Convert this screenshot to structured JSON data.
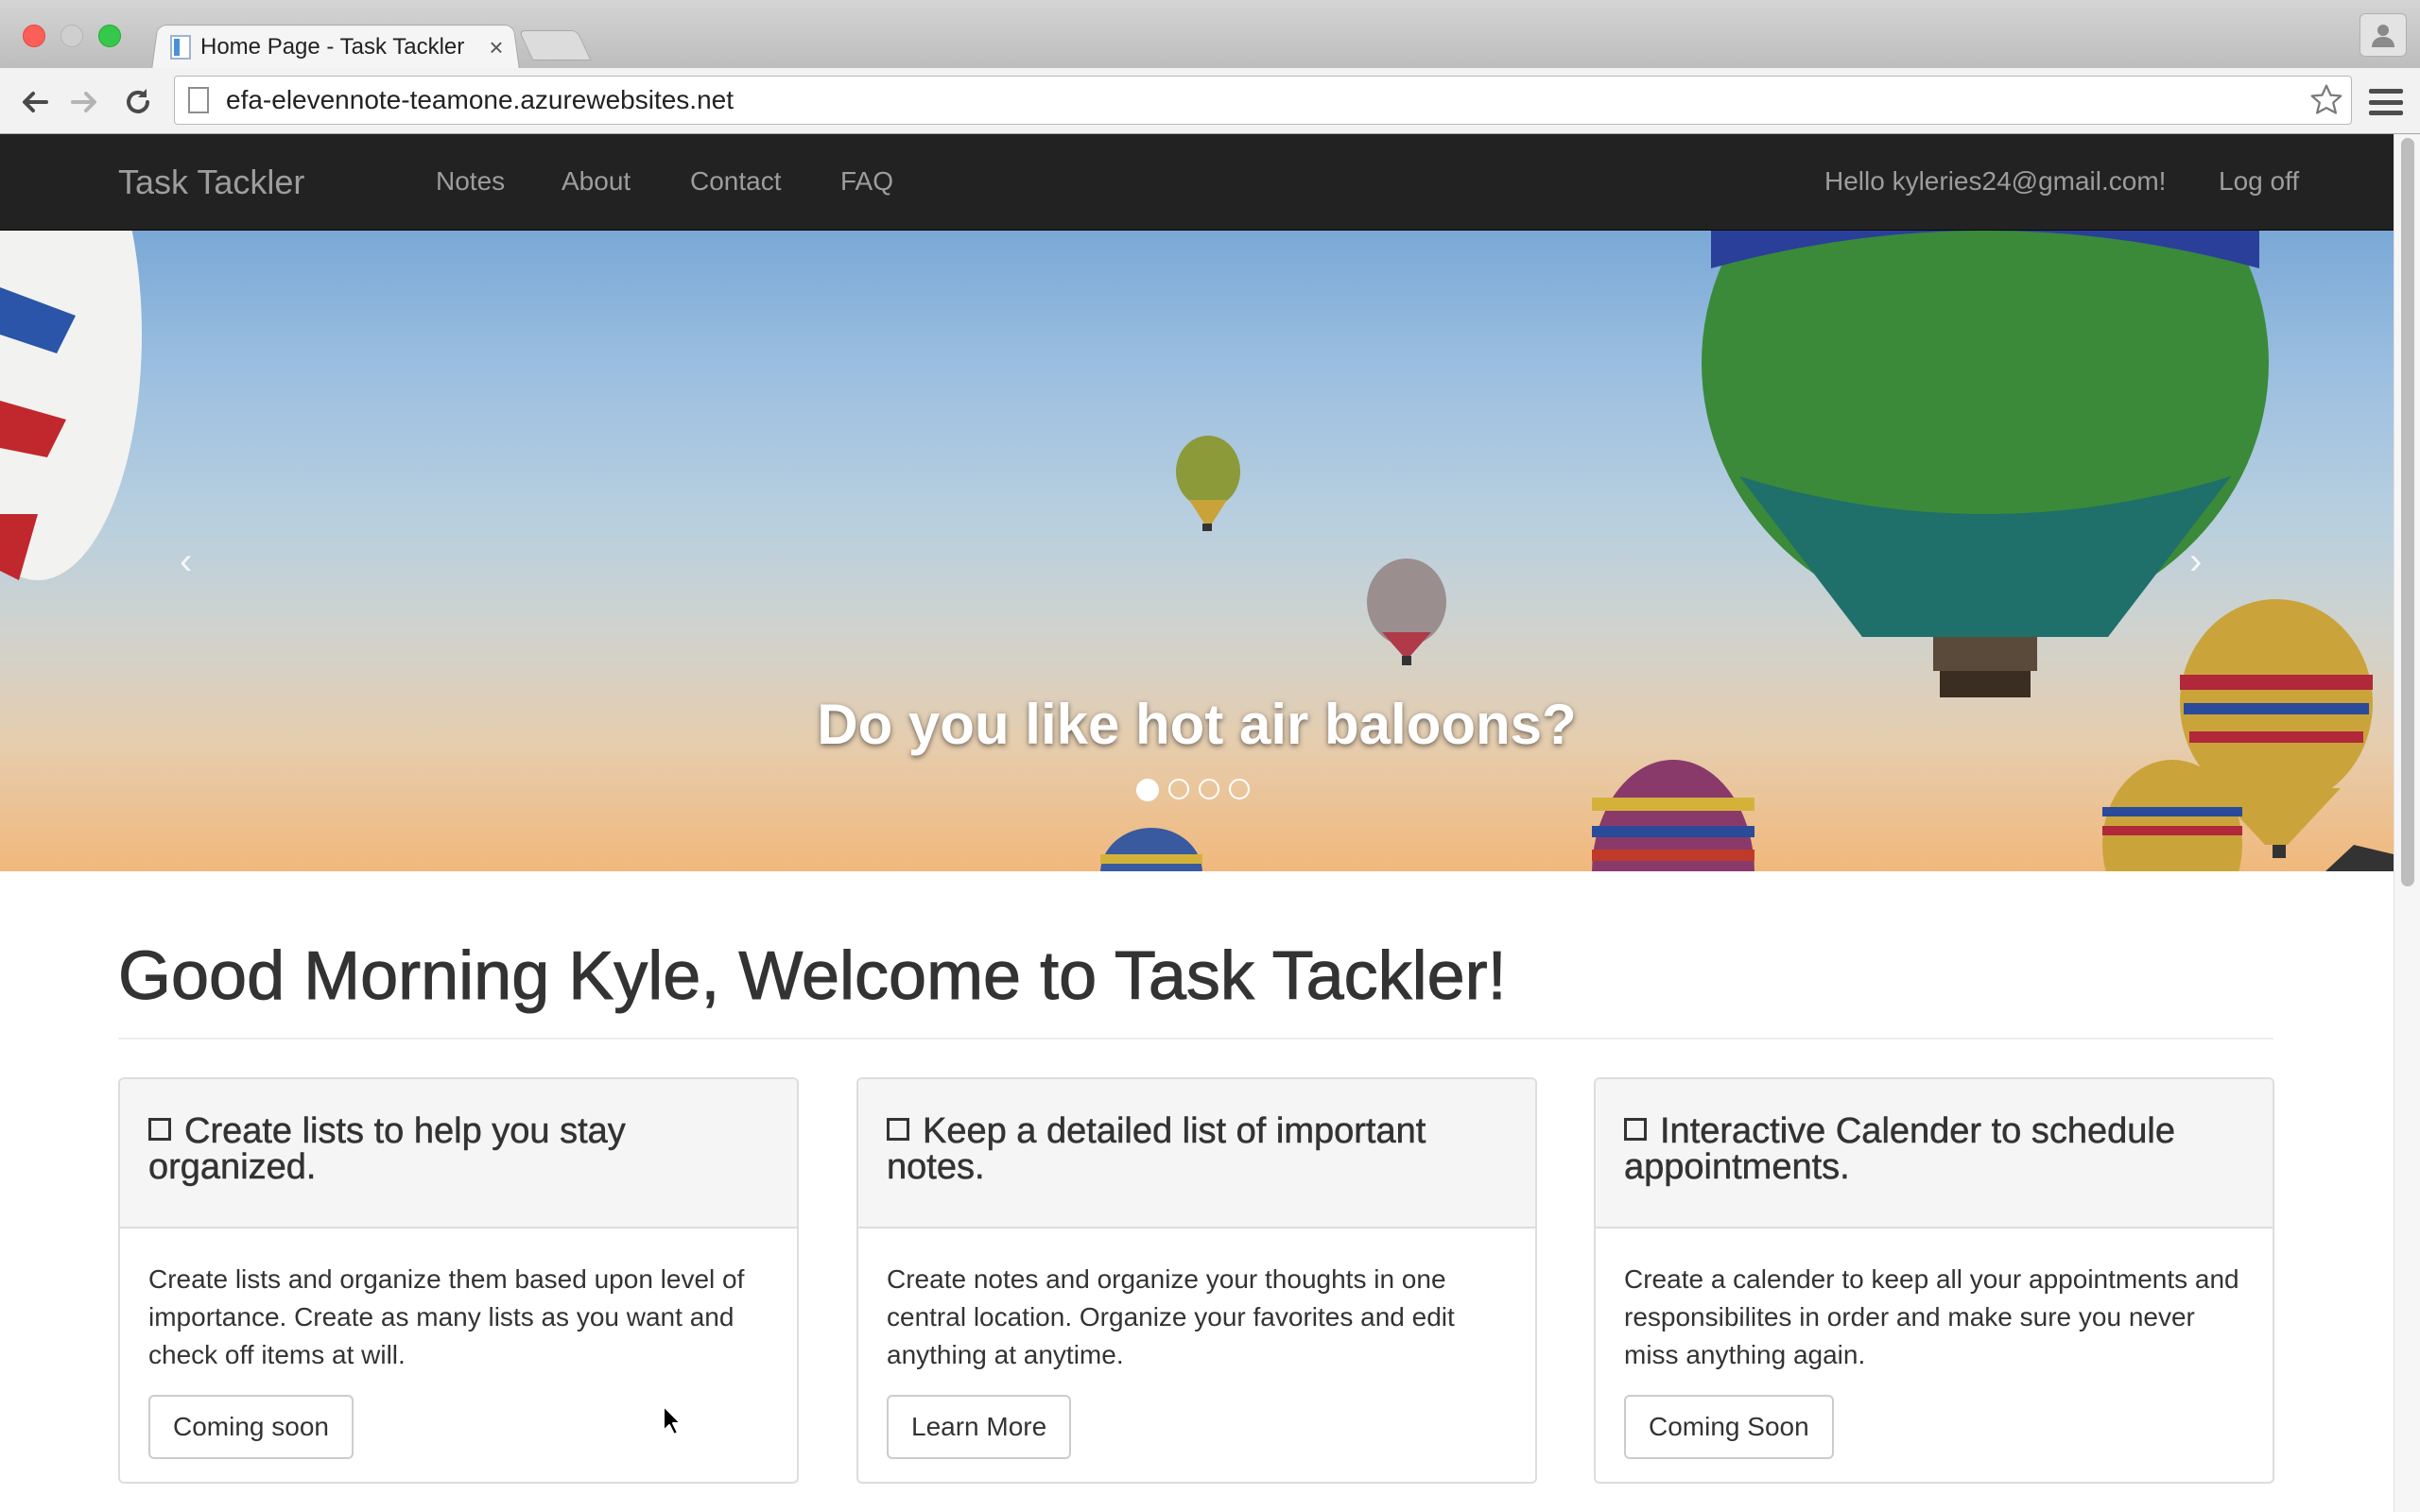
{
  "browser": {
    "tab_title": "Home Page - Task Tackler",
    "tab_close": "×",
    "url": "efa-elevennote-teamone.azurewebsites.net"
  },
  "site_nav": {
    "brand": "Task Tackler",
    "links": [
      "Notes",
      "About",
      "Contact",
      "FAQ"
    ],
    "greeting": "Hello kyleries24@gmail.com!",
    "logoff": "Log off"
  },
  "carousel": {
    "caption": "Do you like hot air baloons?",
    "prev": "‹",
    "next": "›",
    "slide_count": 4,
    "active_index": 0
  },
  "main": {
    "heading": "Good Morning Kyle, Welcome to Task Tackler!",
    "panels": [
      {
        "title": "Create lists to help you stay organized.",
        "text": "Create lists and organize them based upon level of importance. Create as many lists as you want and check off items at will.",
        "button": "Coming soon"
      },
      {
        "title": "Keep a detailed list of important notes.",
        "text": "Create notes and organize your thoughts in one central location. Organize your favorites and edit anything at anytime.",
        "button": "Learn More"
      },
      {
        "title": "Interactive Calender to schedule appointments.",
        "text": "Create a calender to keep all your appointments and responsibilites in order and make sure you never miss anything again.",
        "button": "Coming Soon"
      }
    ]
  },
  "icons": {
    "back": "back-arrow-icon",
    "forward": "forward-arrow-icon",
    "reload": "reload-icon",
    "star": "star-icon",
    "menu": "hamburger-menu-icon",
    "profile": "profile-icon",
    "checkbox": "checkbox-icon"
  },
  "colors": {
    "navbar": "#222222",
    "navbar_text": "#9d9d9d",
    "text": "#333333",
    "panel_head": "#f5f5f5",
    "border": "#dddddd"
  }
}
